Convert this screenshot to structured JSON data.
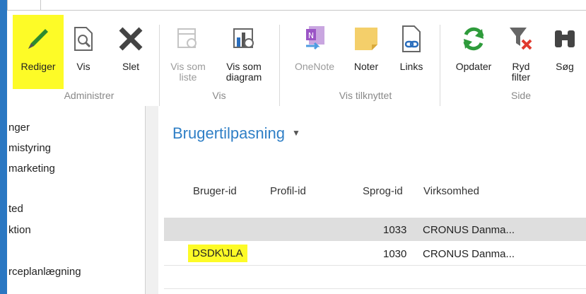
{
  "ribbon": {
    "buttons": [
      {
        "label": "Rediger",
        "icon": "pencil-icon"
      },
      {
        "label": "Vis",
        "icon": "view-document-icon"
      },
      {
        "label": "Slet",
        "icon": "delete-x-icon"
      },
      {
        "label": "Vis som\nliste",
        "icon": "list-view-icon"
      },
      {
        "label": "Vis som\ndiagram",
        "icon": "chart-view-icon"
      },
      {
        "label": "OneNote",
        "icon": "onenote-icon"
      },
      {
        "label": "Noter",
        "icon": "note-icon"
      },
      {
        "label": "Links",
        "icon": "link-icon"
      },
      {
        "label": "Opdater",
        "icon": "refresh-icon"
      },
      {
        "label": "Ryd\nfilter",
        "icon": "clear-filter-icon"
      },
      {
        "label": "Søg",
        "icon": "binoculars-icon"
      }
    ],
    "groups": [
      "Administrer",
      "Vis",
      "Vis tilknyttet",
      "Side"
    ]
  },
  "nav": {
    "items": [
      "nger",
      "mistyring",
      " marketing",
      "",
      "ted",
      "ktion",
      "",
      "rceplanlægning"
    ]
  },
  "page": {
    "title": "Brugertilpasning",
    "columns": [
      "Bruger-id",
      "Profil-id",
      "Sprog-id",
      "Virksomhed"
    ],
    "rows": [
      {
        "bruger_id": "",
        "profil_id": "",
        "sprog_id": "1033",
        "virksomhed": "CRONUS Danma..."
      },
      {
        "bruger_id": "DSDK\\JLA",
        "profil_id": "",
        "sprog_id": "1030",
        "virksomhed": "CRONUS Danma..."
      }
    ]
  },
  "colors": {
    "accent": "#2f7fc6",
    "highlight": "#fdfb27",
    "selected_row": "#dedede"
  }
}
